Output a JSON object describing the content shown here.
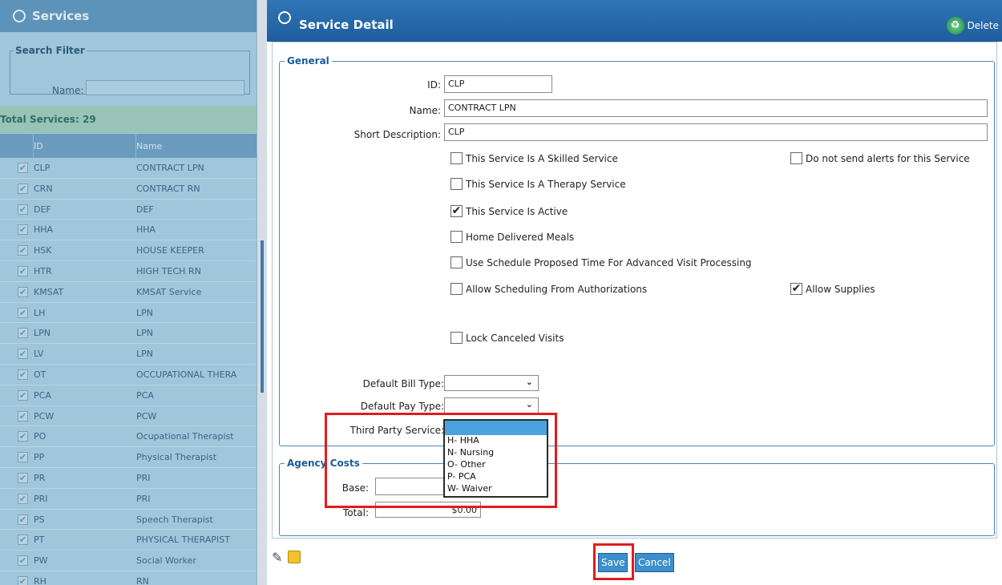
{
  "services_panel": {
    "title": "Services",
    "search_filter": {
      "legend": "Search Filter",
      "name_label": "Name:",
      "name_value": ""
    },
    "total_label": "Total Services: 29",
    "columns": [
      "ID",
      "Name"
    ],
    "rows": [
      {
        "id": "CLP",
        "name": "CONTRACT LPN"
      },
      {
        "id": "CRN",
        "name": "CONTRACT RN"
      },
      {
        "id": "DEF",
        "name": "DEF"
      },
      {
        "id": "HHA",
        "name": "HHA"
      },
      {
        "id": "HSK",
        "name": "HOUSE KEEPER"
      },
      {
        "id": "HTR",
        "name": "HIGH TECH RN"
      },
      {
        "id": "KMSAT",
        "name": "KMSAT Service"
      },
      {
        "id": "LH",
        "name": "LPN"
      },
      {
        "id": "LPN",
        "name": "LPN"
      },
      {
        "id": "LV",
        "name": "LPN"
      },
      {
        "id": "OT",
        "name": "OCCUPATIONAL THERA"
      },
      {
        "id": "PCA",
        "name": "PCA"
      },
      {
        "id": "PCW",
        "name": "PCW"
      },
      {
        "id": "PO",
        "name": "Ocupational Therapist"
      },
      {
        "id": "PP",
        "name": "Physical Therapist"
      },
      {
        "id": "PR",
        "name": "PRI"
      },
      {
        "id": "PRI",
        "name": "PRI"
      },
      {
        "id": "PS",
        "name": "Speech Therapist"
      },
      {
        "id": "PT",
        "name": "PHYSICAL THERAPIST"
      },
      {
        "id": "PW",
        "name": "Social Worker"
      },
      {
        "id": "RH",
        "name": "RN"
      }
    ]
  },
  "detail": {
    "title": "Service Detail",
    "delete_label": "Delete",
    "general_legend": "General",
    "id_label": "ID:",
    "id_value": "CLP",
    "name_label": "Name:",
    "name_value": "CONTRACT LPN",
    "short_desc_label": "Short Description:",
    "short_desc_value": "CLP",
    "checkboxes": {
      "skilled": {
        "label": "This Service Is A Skilled Service",
        "checked": false
      },
      "no_alerts": {
        "label": "Do not send alerts for this Service",
        "checked": false
      },
      "therapy": {
        "label": "This Service Is A Therapy Service",
        "checked": false
      },
      "active": {
        "label": "This Service Is Active",
        "checked": true
      },
      "meals": {
        "label": "Home Delivered Meals",
        "checked": false
      },
      "proposed_time": {
        "label": "Use Schedule Proposed Time For Advanced Visit Processing",
        "checked": false
      },
      "auth_scheduling": {
        "label": "Allow Scheduling From Authorizations",
        "checked": false
      },
      "supplies": {
        "label": "Allow Supplies",
        "checked": true
      },
      "lock_canceled": {
        "label": "Lock Canceled Visits",
        "checked": false
      }
    },
    "bill_type_label": "Default Bill Type:",
    "pay_type_label": "Default Pay Type:",
    "third_party_label": "Third Party Service:",
    "third_party_options": [
      "H- HHA",
      "N- Nursing",
      "O- Other",
      "P- PCA",
      "W- Waiver"
    ],
    "agency_costs_legend": "Agency Costs",
    "base_label": "Base:",
    "total_label": "Total:",
    "total_value": "$0.00",
    "save_label": "Save",
    "cancel_label": "Cancel",
    "check_glyph": "✔",
    "chevron_glyph": "⌄"
  }
}
